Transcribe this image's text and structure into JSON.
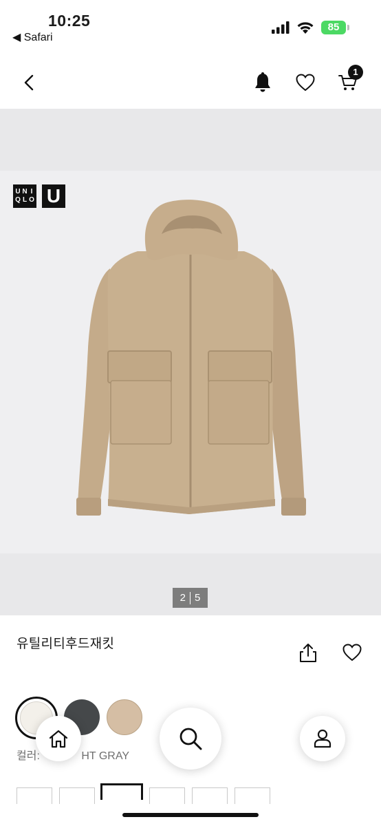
{
  "status_bar": {
    "time": "10:25",
    "back_app": "◀ Safari",
    "battery": "85"
  },
  "header": {
    "back_icon": "chevron-left-icon",
    "notification_icon": "bell-icon",
    "wishlist_icon": "heart-icon",
    "cart_icon": "cart-icon",
    "cart_count": "1"
  },
  "gallery": {
    "brand_logo_text": "UNIQLO",
    "sub_logo_text": "U",
    "current_page": "2",
    "total_pages": "5"
  },
  "product": {
    "name": "유틸리티후드재킷",
    "share_icon": "share-icon",
    "favorite_icon": "heart-icon"
  },
  "colors": {
    "swatches": [
      {
        "name": "off-white",
        "hex": "#f3f0ea",
        "selected": true
      },
      {
        "name": "dark-gray",
        "hex": "#45484a",
        "selected": false
      },
      {
        "name": "beige",
        "hex": "#d5bea4",
        "selected": false
      }
    ],
    "label_prefix": "컬러:",
    "label_value": "HT GRAY"
  },
  "sizes": {
    "selected_index": 2
  },
  "bottom_nav": {
    "home_icon": "home-icon",
    "search_icon": "search-icon",
    "account_icon": "user-icon"
  }
}
